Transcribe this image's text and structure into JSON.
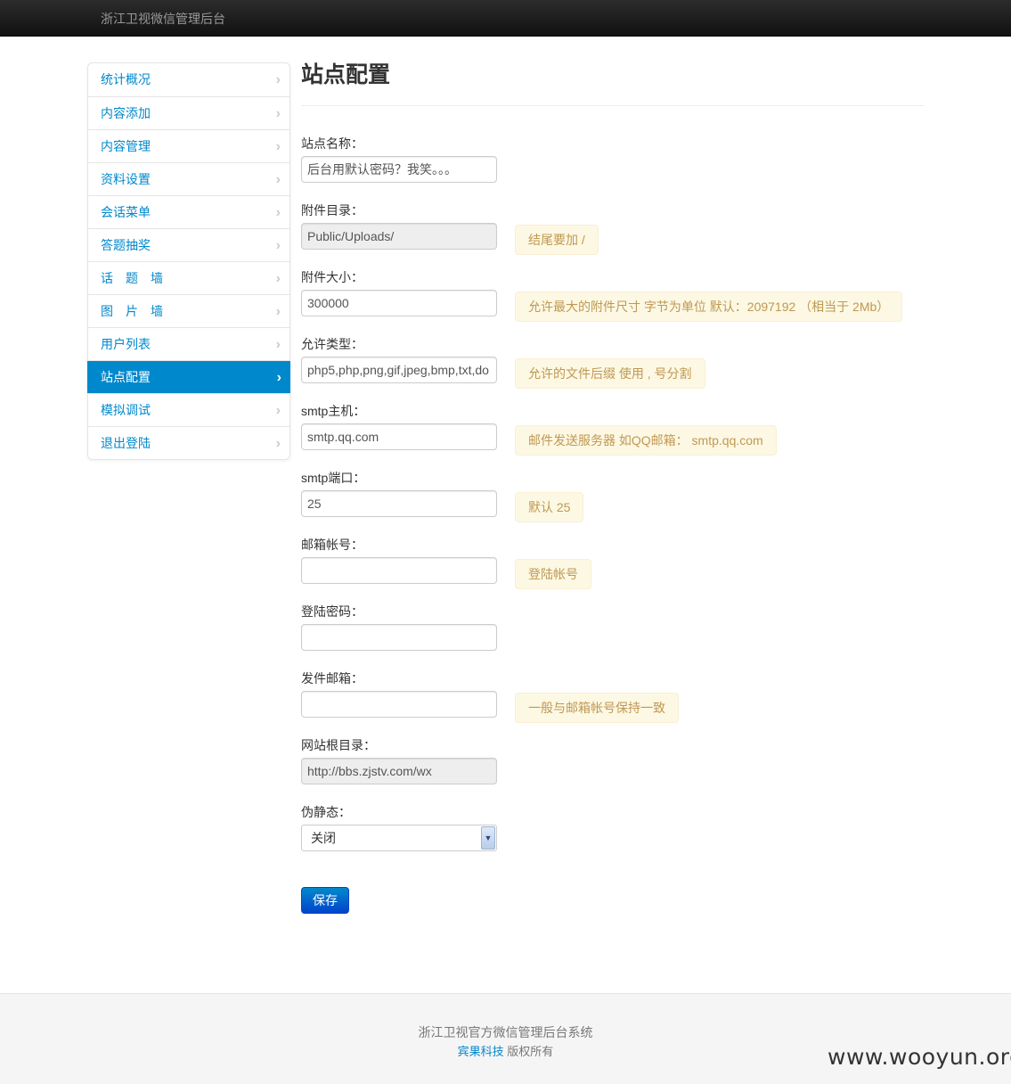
{
  "navbar": {
    "brand": "浙江卫视微信管理后台"
  },
  "sidebar": {
    "items": [
      {
        "label": "统计概况"
      },
      {
        "label": "内容添加"
      },
      {
        "label": "内容管理"
      },
      {
        "label": "资料设置"
      },
      {
        "label": "会话菜单"
      },
      {
        "label": "答题抽奖"
      },
      {
        "label": "话　题　墙"
      },
      {
        "label": "图　片　墙"
      },
      {
        "label": "用户列表"
      },
      {
        "label": "站点配置",
        "active": true
      },
      {
        "label": "模拟调试"
      },
      {
        "label": "退出登陆"
      }
    ],
    "chevron": "›"
  },
  "main": {
    "title": "站点配置",
    "fields": {
      "site_name": {
        "label": "站点名称：",
        "value": "后台用默认密码？我笑。。。"
      },
      "upload_dir": {
        "label": "附件目录：",
        "value": "Public/Uploads/",
        "hint": "结尾要加 /"
      },
      "upload_size": {
        "label": "附件大小：",
        "value": "300000",
        "hint": "允许最大的附件尺寸 字节为单位 默认：2097192 （相当于 2Mb）"
      },
      "allow_types": {
        "label": "允许类型：",
        "value": "php5,php,png,gif,jpeg,bmp,txt,do",
        "hint": "允许的文件后缀 使用 , 号分割"
      },
      "smtp_host": {
        "label": "smtp主机：",
        "value": "smtp.qq.com",
        "hint": "邮件发送服务器 如QQ邮箱： smtp.qq.com"
      },
      "smtp_port": {
        "label": "smtp端口：",
        "value": "25",
        "hint": "默认 25"
      },
      "mail_account": {
        "label": "邮箱帐号：",
        "value": "",
        "hint": "登陆帐号"
      },
      "login_password": {
        "label": "登陆密码：",
        "value": ""
      },
      "sender_mail": {
        "label": "发件邮箱：",
        "value": "",
        "hint": "一般与邮箱帐号保持一致"
      },
      "site_root": {
        "label": "网站根目录：",
        "value": "http://bbs.zjstv.com/wx"
      },
      "rewrite": {
        "label": "伪静态：",
        "selected": "关闭"
      }
    },
    "save_label": "保存"
  },
  "footer": {
    "line1": "浙江卫视官方微信管理后台系统",
    "company": "宾果科技",
    "rights": " 版权所有"
  },
  "watermark": "www.wooyun.org",
  "colors": {
    "accent": "#0088cc",
    "hint_bg": "#fcf8e3",
    "hint_text": "#c09853",
    "navbar": "#1b1b1b"
  }
}
